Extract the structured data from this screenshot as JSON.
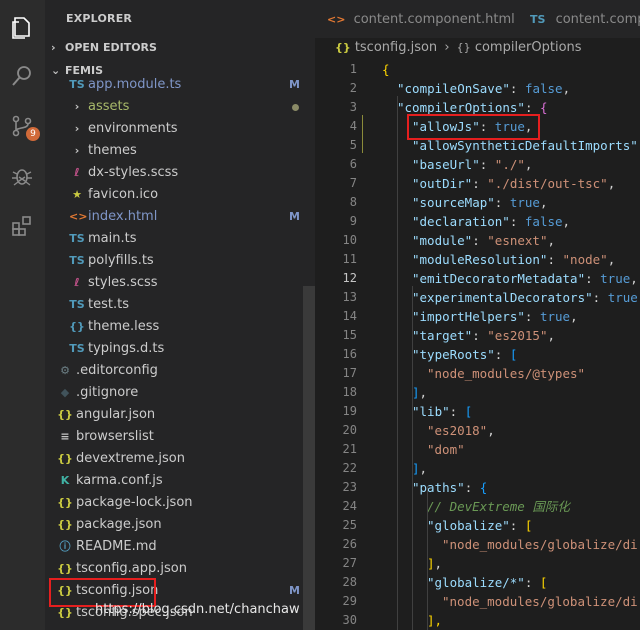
{
  "sidebar": {
    "title": "EXPLORER",
    "open_editors": "OPEN EDITORS",
    "project": "FEMIS",
    "badge_count": "9",
    "items": [
      {
        "name": "app.module.ts",
        "icon": "TS",
        "icon_color": "#519aba",
        "name_color": "#7f96c8",
        "mark": "M"
      },
      {
        "name": "assets",
        "icon": "›",
        "icon_color": "#c5c5c5",
        "name_color": "#a8b96a",
        "dot": true
      },
      {
        "name": "environments",
        "icon": "›",
        "icon_color": "#c5c5c5",
        "name_color": "#cccccc"
      },
      {
        "name": "themes",
        "icon": "›",
        "icon_color": "#c5c5c5",
        "name_color": "#cccccc"
      },
      {
        "name": "dx-styles.scss",
        "icon": "ℓ",
        "icon_color": "#c6538c",
        "name_color": "#cccccc"
      },
      {
        "name": "favicon.ico",
        "icon": "★",
        "icon_color": "#cbcb41",
        "name_color": "#cccccc"
      },
      {
        "name": "index.html",
        "icon": "<>",
        "icon_color": "#e37933",
        "name_color": "#7f96c8",
        "mark": "M"
      },
      {
        "name": "main.ts",
        "icon": "TS",
        "icon_color": "#519aba",
        "name_color": "#cccccc"
      },
      {
        "name": "polyfills.ts",
        "icon": "TS",
        "icon_color": "#519aba",
        "name_color": "#cccccc"
      },
      {
        "name": "styles.scss",
        "icon": "ℓ",
        "icon_color": "#c6538c",
        "name_color": "#cccccc"
      },
      {
        "name": "test.ts",
        "icon": "TS",
        "icon_color": "#519aba",
        "name_color": "#cccccc"
      },
      {
        "name": "theme.less",
        "icon": "{}",
        "icon_color": "#519aba",
        "name_color": "#cccccc"
      },
      {
        "name": "typings.d.ts",
        "icon": "TS",
        "icon_color": "#519aba",
        "name_color": "#cccccc"
      },
      {
        "name": ".editorconfig",
        "icon": "⚙",
        "icon_color": "#6d8086",
        "name_color": "#cccccc"
      },
      {
        "name": ".gitignore",
        "icon": "◆",
        "icon_color": "#41535b",
        "name_color": "#cccccc"
      },
      {
        "name": "angular.json",
        "icon": "{}",
        "icon_color": "#cbcb41",
        "name_color": "#cccccc"
      },
      {
        "name": "browserslist",
        "icon": "≡",
        "icon_color": "#c5c5c5",
        "name_color": "#cccccc"
      },
      {
        "name": "devextreme.json",
        "icon": "{}",
        "icon_color": "#cbcb41",
        "name_color": "#cccccc"
      },
      {
        "name": "karma.conf.js",
        "icon": "K",
        "icon_color": "#40b2a4",
        "name_color": "#cccccc"
      },
      {
        "name": "package-lock.json",
        "icon": "{}",
        "icon_color": "#cbcb41",
        "name_color": "#cccccc"
      },
      {
        "name": "package.json",
        "icon": "{}",
        "icon_color": "#cbcb41",
        "name_color": "#cccccc"
      },
      {
        "name": "README.md",
        "icon": "ⓘ",
        "icon_color": "#519aba",
        "name_color": "#cccccc"
      },
      {
        "name": "tsconfig.app.json",
        "icon": "{}",
        "icon_color": "#cbcb41",
        "name_color": "#cccccc"
      },
      {
        "name": "tsconfig.json",
        "icon": "{}",
        "icon_color": "#cbcb41",
        "name_color": "#cccccc",
        "mark": "M"
      },
      {
        "name": "tsconfig.spec.json",
        "icon": "{}",
        "icon_color": "#cbcb41",
        "name_color": "#cccccc"
      }
    ]
  },
  "tabs": [
    {
      "label": "content.component.html",
      "icon": "<>",
      "icon_color": "#e37933"
    },
    {
      "label": "content.compon",
      "icon": "TS",
      "icon_color": "#519aba"
    }
  ],
  "breadcrumb": {
    "file": "tsconfig.json",
    "sep": "›",
    "node": "compilerOptions"
  },
  "code": {
    "line_numbers": [
      "1",
      "2",
      "3",
      "4",
      "5",
      "6",
      "7",
      "8",
      "9",
      "10",
      "11",
      "12",
      "13",
      "14",
      "15",
      "16",
      "17",
      "18",
      "19",
      "20",
      "21",
      "22",
      "23",
      "24",
      "25",
      "26",
      "27",
      "28",
      "29",
      "30"
    ],
    "lines": [
      {
        "indent": 0,
        "t": [
          [
            "{",
            "br"
          ]
        ]
      },
      {
        "indent": 1,
        "t": [
          [
            "\"compileOnSave\"",
            "k"
          ],
          [
            ": ",
            "p"
          ],
          [
            "false",
            "b"
          ],
          [
            ",",
            "p"
          ]
        ]
      },
      {
        "indent": 1,
        "t": [
          [
            "\"compilerOptions\"",
            "k"
          ],
          [
            ": ",
            "p"
          ],
          [
            "{",
            "br2"
          ]
        ]
      },
      {
        "indent": 2,
        "t": [
          [
            "\"allowJs\"",
            "k"
          ],
          [
            ": ",
            "p"
          ],
          [
            "true",
            "b"
          ],
          [
            ",",
            "p"
          ]
        ]
      },
      {
        "indent": 2,
        "t": [
          [
            "\"allowSyntheticDefaultImports\"",
            "k"
          ],
          [
            ": true,",
            "p"
          ]
        ]
      },
      {
        "indent": 2,
        "t": [
          [
            "\"baseUrl\"",
            "k"
          ],
          [
            ": ",
            "p"
          ],
          [
            "\"./\"",
            "s"
          ],
          [
            ",",
            "p"
          ]
        ]
      },
      {
        "indent": 2,
        "t": [
          [
            "\"outDir\"",
            "k"
          ],
          [
            ": ",
            "p"
          ],
          [
            "\"./dist/out-tsc\"",
            "s"
          ],
          [
            ",",
            "p"
          ]
        ]
      },
      {
        "indent": 2,
        "t": [
          [
            "\"sourceMap\"",
            "k"
          ],
          [
            ": ",
            "p"
          ],
          [
            "true",
            "b"
          ],
          [
            ",",
            "p"
          ]
        ]
      },
      {
        "indent": 2,
        "t": [
          [
            "\"declaration\"",
            "k"
          ],
          [
            ": ",
            "p"
          ],
          [
            "false",
            "b"
          ],
          [
            ",",
            "p"
          ]
        ]
      },
      {
        "indent": 2,
        "t": [
          [
            "\"module\"",
            "k"
          ],
          [
            ": ",
            "p"
          ],
          [
            "\"esnext\"",
            "s"
          ],
          [
            ",",
            "p"
          ]
        ]
      },
      {
        "indent": 2,
        "t": [
          [
            "\"moduleResolution\"",
            "k"
          ],
          [
            ": ",
            "p"
          ],
          [
            "\"node\"",
            "s"
          ],
          [
            ",",
            "p"
          ]
        ]
      },
      {
        "indent": 2,
        "t": [
          [
            "\"emitDecoratorMetadata\"",
            "k"
          ],
          [
            ": ",
            "p"
          ],
          [
            "true",
            "b"
          ],
          [
            ",",
            "p"
          ]
        ]
      },
      {
        "indent": 2,
        "t": [
          [
            "\"experimentalDecorators\"",
            "k"
          ],
          [
            ": ",
            "p"
          ],
          [
            "true",
            "b"
          ]
        ]
      },
      {
        "indent": 2,
        "t": [
          [
            "\"importHelpers\"",
            "k"
          ],
          [
            ": ",
            "p"
          ],
          [
            "true",
            "b"
          ],
          [
            ",",
            "p"
          ]
        ]
      },
      {
        "indent": 2,
        "t": [
          [
            "\"target\"",
            "k"
          ],
          [
            ": ",
            "p"
          ],
          [
            "\"es2015\"",
            "s"
          ],
          [
            ",",
            "p"
          ]
        ]
      },
      {
        "indent": 2,
        "t": [
          [
            "\"typeRoots\"",
            "k"
          ],
          [
            ": ",
            "p"
          ],
          [
            "[",
            "br3"
          ]
        ]
      },
      {
        "indent": 3,
        "t": [
          [
            "\"node_modules/@types\"",
            "s"
          ]
        ]
      },
      {
        "indent": 2,
        "t": [
          [
            "]",
            "br3"
          ],
          [
            ",",
            "p"
          ]
        ]
      },
      {
        "indent": 2,
        "t": [
          [
            "\"lib\"",
            "k"
          ],
          [
            ": ",
            "p"
          ],
          [
            "[",
            "br3"
          ]
        ]
      },
      {
        "indent": 3,
        "t": [
          [
            "\"es2018\"",
            "s"
          ],
          [
            ",",
            "p"
          ]
        ]
      },
      {
        "indent": 3,
        "t": [
          [
            "\"dom\"",
            "s"
          ]
        ]
      },
      {
        "indent": 2,
        "t": [
          [
            "]",
            "br3"
          ],
          [
            ",",
            "p"
          ]
        ]
      },
      {
        "indent": 2,
        "t": [
          [
            "\"paths\"",
            "k"
          ],
          [
            ": ",
            "p"
          ],
          [
            "{",
            "br3"
          ]
        ]
      },
      {
        "indent": 3,
        "t": [
          [
            "// DevExtreme 国际化",
            "cm"
          ]
        ]
      },
      {
        "indent": 3,
        "t": [
          [
            "\"globalize\"",
            "k"
          ],
          [
            ": ",
            "p"
          ],
          [
            "[",
            "br"
          ]
        ]
      },
      {
        "indent": 4,
        "t": [
          [
            "\"node_modules/globalize/di",
            "s"
          ]
        ]
      },
      {
        "indent": 3,
        "t": [
          [
            "]",
            "br"
          ],
          [
            ",",
            "p"
          ]
        ]
      },
      {
        "indent": 3,
        "t": [
          [
            "\"globalize/*\"",
            "k"
          ],
          [
            ": ",
            "p"
          ],
          [
            "[",
            "br"
          ]
        ]
      },
      {
        "indent": 4,
        "t": [
          [
            "\"node_modules/globalize/di",
            "s"
          ]
        ]
      },
      {
        "indent": 3,
        "t": [
          [
            "],",
            "br"
          ]
        ]
      }
    ]
  },
  "watermark": "https://blog.csdn.net/chanchaw",
  "colors": {
    "highlight": "#e51f1f",
    "accent": "#007acc",
    "badge": "#d16a39"
  }
}
